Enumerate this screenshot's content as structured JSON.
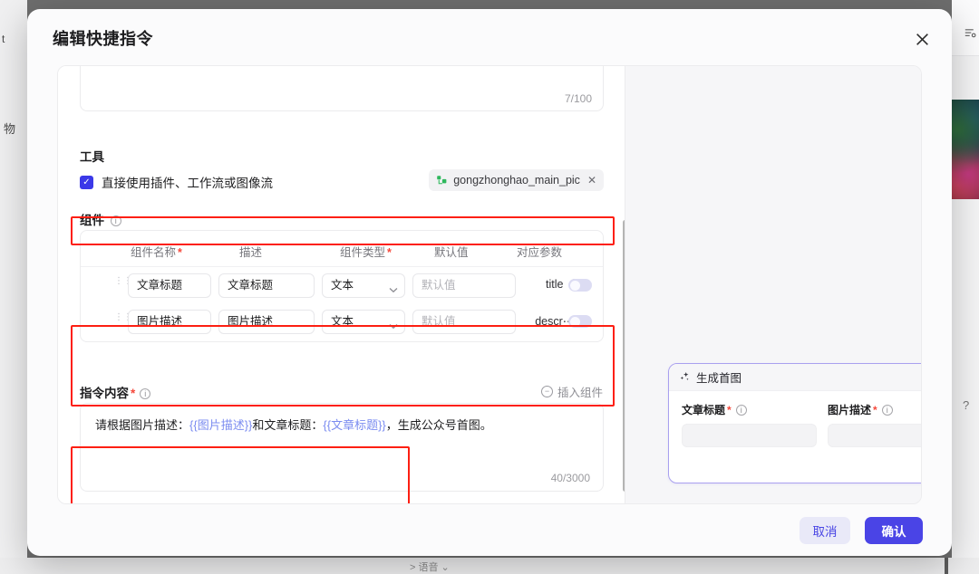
{
  "background": {
    "left_text_top": "t",
    "left_text_mid": "物",
    "right_icon": "list-settings-icon",
    "right_question": "?",
    "bottom_text": "> 语音 ⌄"
  },
  "modal": {
    "title": "编辑快捷指令",
    "close_icon": "✕"
  },
  "name_field": {
    "counter": "7/100"
  },
  "tools_section": {
    "label": "工具",
    "checkbox_checked": true,
    "checkbox_glyph": "✓",
    "checkbox_label": "直接使用插件、工作流或图像流",
    "plugin_tag": {
      "icon": "plugin-icon",
      "name": "gongzhonghao_main_pic",
      "remove_icon": "✕"
    }
  },
  "components_section": {
    "label": "组件",
    "info_icon": "ⓘ",
    "columns": [
      {
        "label": "组件名称",
        "required": true
      },
      {
        "label": "描述",
        "required": false
      },
      {
        "label": "组件类型",
        "required": true
      },
      {
        "label": "默认值",
        "required": false
      },
      {
        "label": "对应参数",
        "required": false
      }
    ],
    "rows": [
      {
        "drag_handle": "⠿",
        "name": "文章标题",
        "description": "文章标题",
        "type": "文本",
        "type_chevron": "⌄",
        "default_placeholder": "默认值",
        "param": "title",
        "param_info": "ⓘ",
        "toggle_on": false
      },
      {
        "drag_handle": "⠿",
        "name": "图片描述",
        "description": "图片描述",
        "type": "文本",
        "type_chevron": "⌄",
        "default_placeholder": "默认值",
        "param": "descr⋯",
        "param_info": "ⓘ",
        "toggle_on": false
      }
    ]
  },
  "instruction_section": {
    "label": "指令内容",
    "required_star": "*",
    "info_icon": "ⓘ",
    "insert_component_label": "插入组件",
    "insert_component_icon": "insert-icon",
    "text_parts": [
      {
        "text": "请根据图片描述：",
        "variable": false
      },
      {
        "text": "{{图片描述}}",
        "variable": true
      },
      {
        "text": "和文章标题：",
        "variable": false
      },
      {
        "text": "{{文章标题}}",
        "variable": true
      },
      {
        "text": "，生成公众号首图。",
        "variable": false
      }
    ],
    "counter": "40/3000"
  },
  "preview_card": {
    "icon": "sparkle-icon",
    "title": "生成首图",
    "close_icon": "✕",
    "fields": [
      {
        "label": "文章标题",
        "required_star": "*",
        "info_icon": "ⓘ",
        "value": ""
      },
      {
        "label": "图片描述",
        "required_star": "*",
        "info_icon": "ⓘ",
        "value": ""
      }
    ],
    "send_icon": "➤"
  },
  "footer": {
    "cancel_label": "取消",
    "confirm_label": "确认"
  },
  "colors": {
    "accent": "#4a44e6",
    "accent_soft": "#e9e9f8",
    "highlight_box": "#fd1f12",
    "variable_text": "#7b8cf0",
    "checkbox": "#3b39e8",
    "preview_border": "#a9a0ef"
  }
}
